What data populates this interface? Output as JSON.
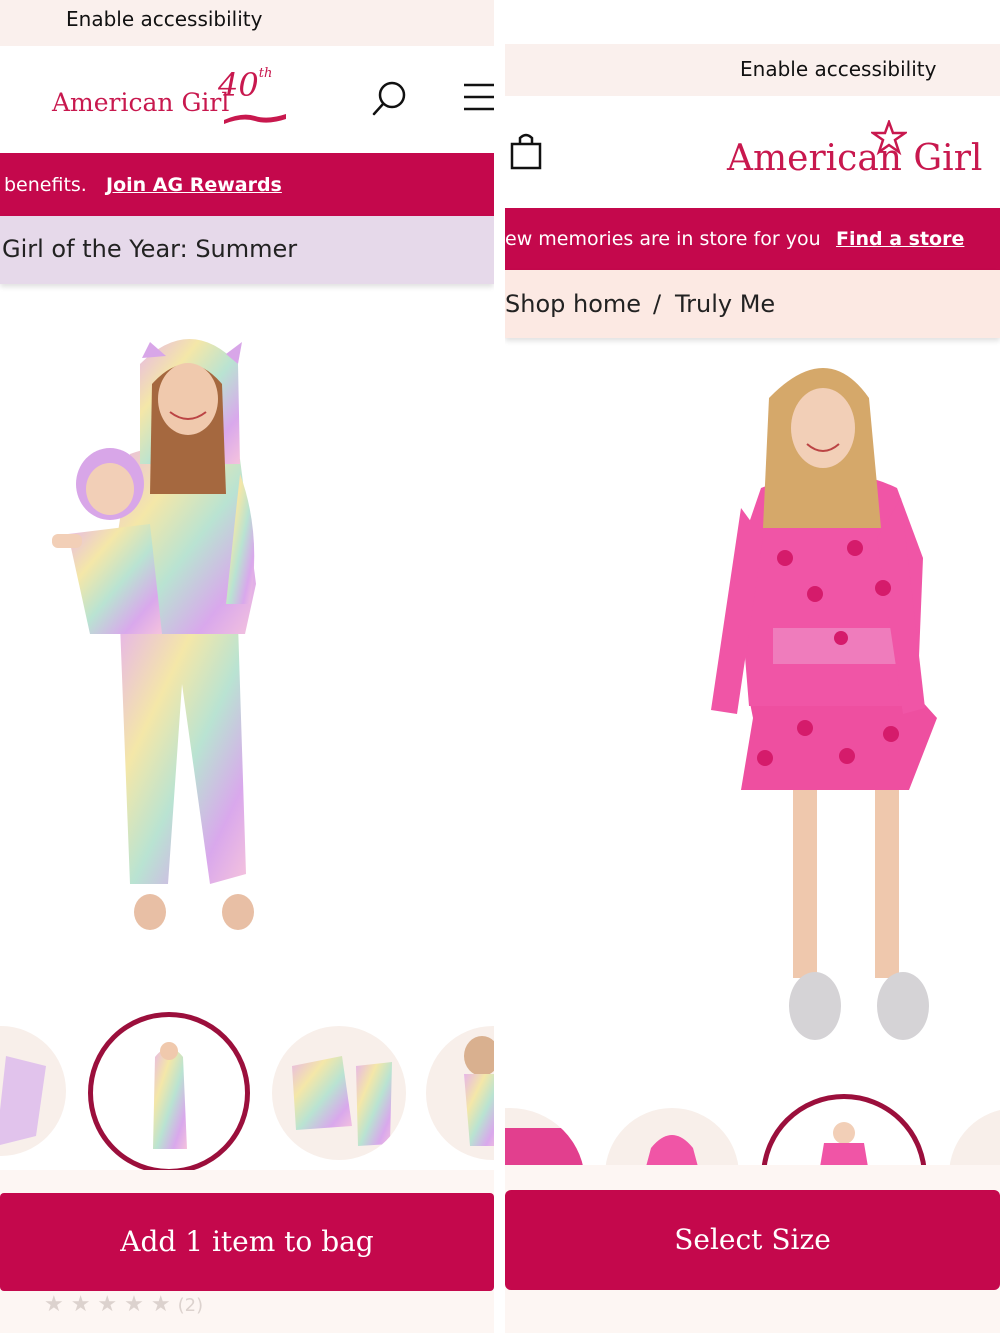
{
  "left": {
    "accessibility_label": "Enable accessibility",
    "logo": {
      "brand": "American Girl",
      "anniversary": "40",
      "anniversary_sup": "th"
    },
    "promo": {
      "text": "benefits.",
      "link": "Join AG Rewards"
    },
    "breadcrumb": "Girl of the Year: Summer",
    "cta_label": "Add 1 item to bag",
    "rating": {
      "stars": 5,
      "count": "(2)"
    }
  },
  "right": {
    "accessibility_label": "Enable accessibility",
    "logo": {
      "brand": "American Girl"
    },
    "promo": {
      "text": "ew memories are in store for you",
      "link": "Find a store"
    },
    "breadcrumb": {
      "home": "Shop home",
      "separator": "/",
      "current": "Truly Me"
    },
    "cta_label": "Select Size"
  },
  "colors": {
    "brand": "#c4084c",
    "logo": "#c8184e",
    "cream": "#faf0ed",
    "lavender": "#e6d9ea",
    "blush": "#fce9e3"
  },
  "icons": [
    "search-icon",
    "menu-icon",
    "bag-icon",
    "star-icon"
  ]
}
